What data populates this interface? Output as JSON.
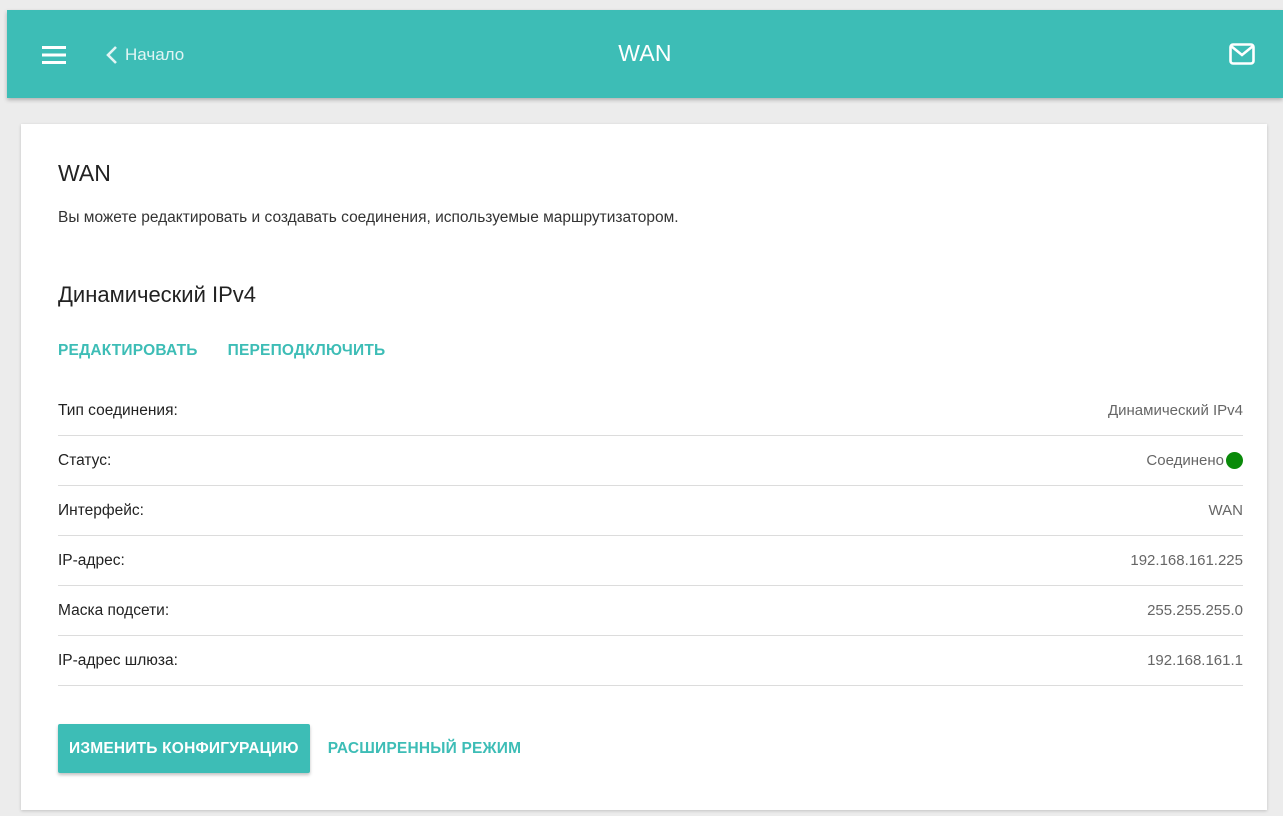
{
  "header": {
    "back_label": "Начало",
    "title": "WAN",
    "menu_icon": "hamburger-menu-icon",
    "back_icon": "chevron-left-icon",
    "mail_icon": "mail-icon"
  },
  "page": {
    "title": "WAN",
    "description": "Вы можете редактировать и создавать соединения, используемые маршрутизатором."
  },
  "connection": {
    "name": "Динамический IPv4",
    "actions": {
      "edit": "РЕДАКТИРОВАТЬ",
      "reconnect": "ПЕРЕПОДКЛЮЧИТЬ"
    },
    "rows": [
      {
        "label": "Тип соединения:",
        "value": "Динамический IPv4"
      },
      {
        "label": "Статус:",
        "value": "Соединено"
      },
      {
        "label": "Интерфейс:",
        "value": "WAN"
      },
      {
        "label": "IP-адрес:",
        "value": "192.168.161.225"
      },
      {
        "label": "Маска подсети:",
        "value": "255.255.255.0"
      },
      {
        "label": "IP-адрес шлюза:",
        "value": "192.168.161.1"
      }
    ],
    "status_color": "#0a8a0a"
  },
  "footer": {
    "change_config": "ИЗМЕНИТЬ КОНФИГУРАЦИЮ",
    "advanced_mode": "РАСШИРЕННЫЙ РЕЖИМ"
  },
  "colors": {
    "accent": "#3dbdb6",
    "background": "#ececec",
    "card": "#ffffff"
  }
}
